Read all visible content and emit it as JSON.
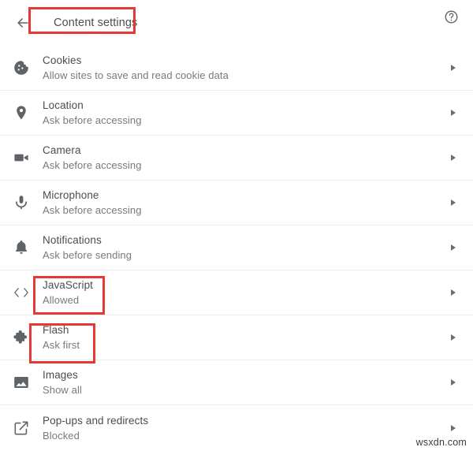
{
  "header": {
    "back_icon": "arrow-left-icon",
    "title": "Content settings",
    "help_icon": "help-circle-icon"
  },
  "colors": {
    "highlight": "#e53935",
    "text_primary": "#4a4d51",
    "text_secondary": "#79797c",
    "icon": "#5f6368",
    "divider": "#eceff1",
    "background": "#ffffff"
  },
  "settings": [
    {
      "icon": "cookie-icon",
      "title": "Cookies",
      "subtitle": "Allow sites to save and read cookie data",
      "chevron": "chevron-right-icon",
      "highlighted": false
    },
    {
      "icon": "location-pin-icon",
      "title": "Location",
      "subtitle": "Ask before accessing",
      "chevron": "chevron-right-icon",
      "highlighted": false
    },
    {
      "icon": "video-camera-icon",
      "title": "Camera",
      "subtitle": "Ask before accessing",
      "chevron": "chevron-right-icon",
      "highlighted": false
    },
    {
      "icon": "microphone-icon",
      "title": "Microphone",
      "subtitle": "Ask before accessing",
      "chevron": "chevron-right-icon",
      "highlighted": false
    },
    {
      "icon": "bell-icon",
      "title": "Notifications",
      "subtitle": "Ask before sending",
      "chevron": "chevron-right-icon",
      "highlighted": false
    },
    {
      "icon": "code-brackets-icon",
      "title": "JavaScript",
      "subtitle": "Allowed",
      "chevron": "chevron-right-icon",
      "highlighted": true
    },
    {
      "icon": "puzzle-piece-icon",
      "title": "Flash",
      "subtitle": "Ask first",
      "chevron": "chevron-right-icon",
      "highlighted": true
    },
    {
      "icon": "image-icon",
      "title": "Images",
      "subtitle": "Show all",
      "chevron": "chevron-right-icon",
      "highlighted": false
    },
    {
      "icon": "external-link-icon",
      "title": "Pop-ups and redirects",
      "subtitle": "Blocked",
      "chevron": "chevron-right-icon",
      "highlighted": false
    }
  ],
  "watermark": "wsxdn.com"
}
